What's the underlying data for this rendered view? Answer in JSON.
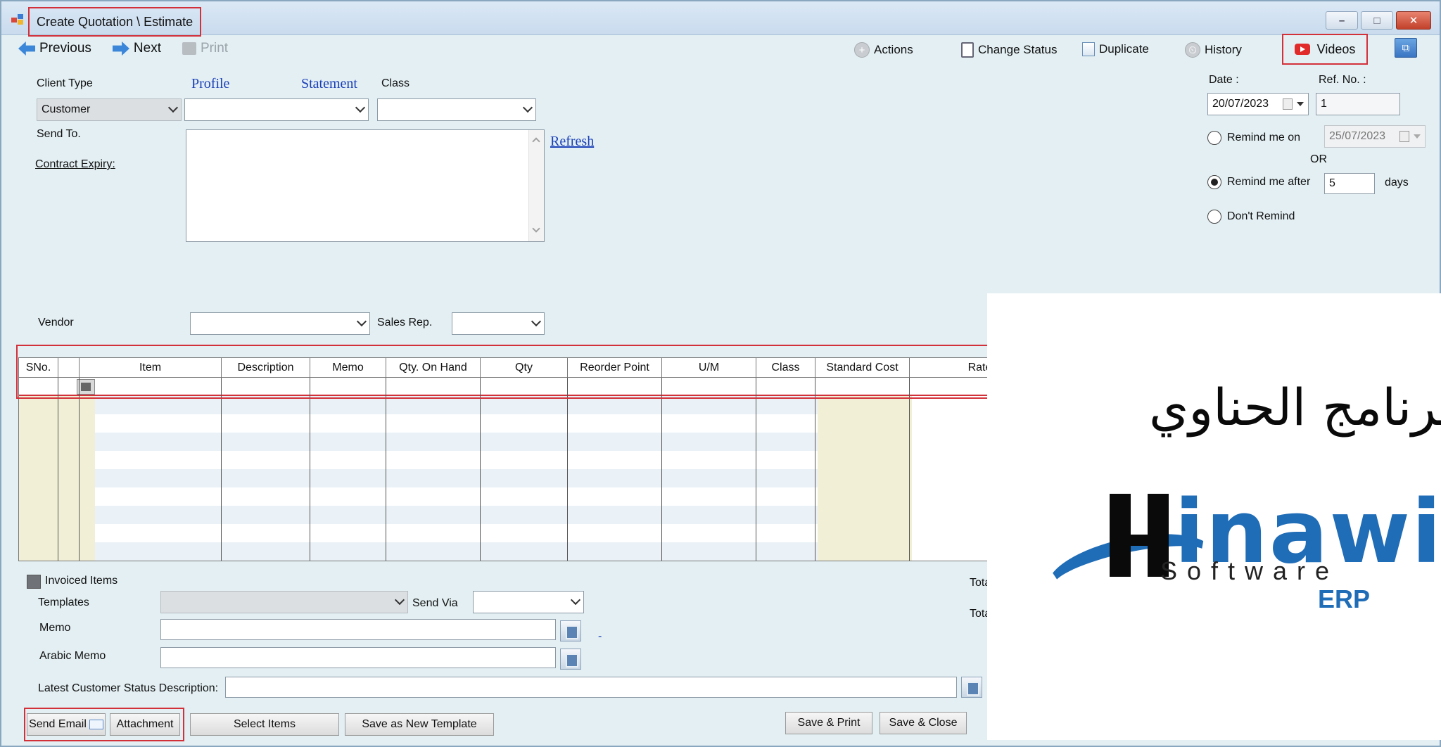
{
  "window": {
    "title": "Create Quotation \\ Estimate",
    "minimize": "–",
    "maximize": "□",
    "close": "✕"
  },
  "toolbar": {
    "previous": "Previous",
    "next": "Next",
    "print": "Print",
    "actions": "Actions",
    "change_status": "Change Status",
    "duplicate": "Duplicate",
    "history": "History",
    "videos": "Videos",
    "restore_icon": "⧉"
  },
  "form": {
    "client_type_label": "Client Type",
    "client_type_value": "Customer",
    "profile_link": "Profile",
    "statement_link": "Statement",
    "class_label": "Class",
    "send_to_label": "Send To.",
    "contract_expiry_label": "Contract Expiry:",
    "refresh_link": "Refresh",
    "vendor_label": "Vendor",
    "sales_rep_label": "Sales Rep.",
    "date_label": "Date :",
    "date_value": "20/07/2023",
    "ref_label": "Ref. No. :",
    "ref_value": "1",
    "remind_on_label": "Remind me on",
    "remind_on_value": "25/07/2023",
    "or_label": "OR",
    "remind_after_label": "Remind me after",
    "remind_after_value": "5",
    "days_label": "days",
    "dont_remind_label": "Don't Remind",
    "reminder_selected": "Remind me after"
  },
  "grid": {
    "columns": [
      "SNo.",
      "",
      "Item",
      "Description",
      "Memo",
      "Qty. On Hand",
      "Qty",
      "Reorder Point",
      "U/M",
      "Class",
      "Standard Cost",
      "Rate"
    ]
  },
  "footer": {
    "invoiced_items": "Invoiced Items",
    "templates_label": "Templates",
    "send_via_label": "Send Via",
    "memo_label": "Memo",
    "arabic_memo_label": "Arabic Memo",
    "latest_status_label": "Latest Customer Status Description:",
    "total_1": "Tota",
    "total_2": "Tota",
    "dash": "-"
  },
  "buttons": {
    "send_email": "Send Email",
    "attachment": "Attachment",
    "select_items": "Select Items",
    "save_template": "Save as New Template",
    "save_print": "Save & Print",
    "save_close": "Save & Close"
  },
  "logo": {
    "arabic": "برنامج الحناوي",
    "brand": "inawi",
    "software": "Software",
    "erp": "ERP"
  },
  "colors": {
    "window_bg": "#e3eff3",
    "highlight": "#d3313a",
    "link": "#1a3fb8",
    "brand_blue": "#1f6cb7"
  }
}
